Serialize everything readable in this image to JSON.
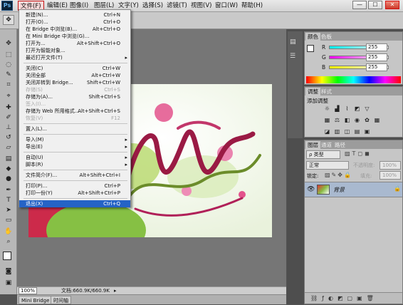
{
  "app": {
    "logo": "Ps"
  },
  "menubar": {
    "items": [
      "文件(F)",
      "编辑(E)",
      "图像(I)",
      "图层(L)",
      "文字(Y)",
      "选择(S)",
      "滤镜(T)",
      "视图(V)",
      "窗口(W)",
      "帮助(H)"
    ]
  },
  "window_controls": {
    "minimize": "—",
    "maximize": "☐",
    "close": "✕"
  },
  "file_menu": {
    "groups": [
      [
        {
          "label": "新建(N)...",
          "shortcut": "Ctrl+N"
        },
        {
          "label": "打开(O)...",
          "shortcut": "Ctrl+O"
        },
        {
          "label": "在 Bridge 中浏览(B)...",
          "shortcut": "Alt+Ctrl+O"
        },
        {
          "label": "在 Mini Bridge 中浏览(G)...",
          "shortcut": ""
        },
        {
          "label": "打开为...",
          "shortcut": "Alt+Shift+Ctrl+O"
        },
        {
          "label": "打开为智能对象...",
          "shortcut": ""
        },
        {
          "label": "最近打开文件(T)",
          "shortcut": "",
          "submenu": true
        }
      ],
      [
        {
          "label": "关闭(C)",
          "shortcut": "Ctrl+W"
        },
        {
          "label": "关闭全部",
          "shortcut": "Alt+Ctrl+W"
        },
        {
          "label": "关闭并转到 Bridge...",
          "shortcut": "Shift+Ctrl+W"
        },
        {
          "label": "存储(S)",
          "shortcut": "Ctrl+S",
          "disabled": true
        },
        {
          "label": "存储为(A)...",
          "shortcut": "Shift+Ctrl+S"
        },
        {
          "label": "签入(I)...",
          "shortcut": "",
          "disabled": true
        },
        {
          "label": "存储为 Web 所用格式...",
          "shortcut": "Alt+Shift+Ctrl+S"
        },
        {
          "label": "恢复(V)",
          "shortcut": "F12",
          "disabled": true
        }
      ],
      [
        {
          "label": "置入(L)...",
          "shortcut": ""
        }
      ],
      [
        {
          "label": "导入(M)",
          "shortcut": "",
          "submenu": true
        },
        {
          "label": "导出(E)",
          "shortcut": "",
          "submenu": true
        }
      ],
      [
        {
          "label": "自动(U)",
          "shortcut": "",
          "submenu": true
        },
        {
          "label": "脚本(R)",
          "shortcut": "",
          "submenu": true
        }
      ],
      [
        {
          "label": "文件简介(F)...",
          "shortcut": "Alt+Shift+Ctrl+I"
        }
      ],
      [
        {
          "label": "打印(P)...",
          "shortcut": "Ctrl+P"
        },
        {
          "label": "打印一份(Y)",
          "shortcut": "Alt+Shift+Ctrl+P"
        }
      ],
      [
        {
          "label": "退出(X)",
          "shortcut": "Ctrl+Q",
          "highlighted": true
        }
      ]
    ]
  },
  "status": {
    "zoom": "100%",
    "doc_info": "文档:660.9K/660.9K"
  },
  "bottom_tabs": [
    "Mini Bridge",
    "时间轴"
  ],
  "color_panel": {
    "tabs": [
      "颜色",
      "色板"
    ],
    "channels": [
      {
        "label": "R",
        "value": "255"
      },
      {
        "label": "G",
        "value": "255"
      },
      {
        "label": "B",
        "value": "255"
      }
    ]
  },
  "adjust_panel": {
    "tabs": [
      "调整",
      "样式"
    ],
    "title": "添加调整"
  },
  "layers_panel": {
    "tabs": [
      "图层",
      "通道",
      "路径"
    ],
    "filter_kind": "ρ 类型",
    "blend_mode": "正常",
    "opacity_label": "不透明度:",
    "opacity_value": "100%",
    "lock_label": "锁定:",
    "fill_label": "填充:",
    "fill_value": "100%",
    "layer_name": "背景"
  },
  "colors": {
    "accent": "#2563c6",
    "close": "#cc3a2a"
  }
}
